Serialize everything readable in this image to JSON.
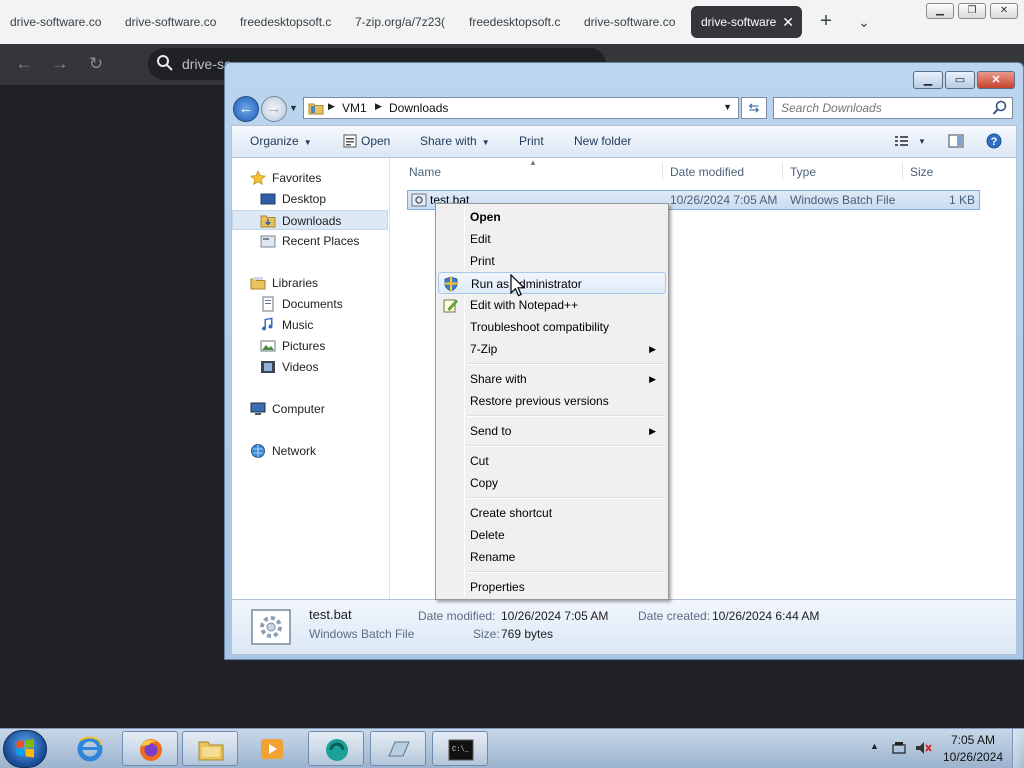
{
  "browser": {
    "tabs": [
      {
        "label": "drive-software.co"
      },
      {
        "label": "drive-software.co"
      },
      {
        "label": "freedesktopsoft.c"
      },
      {
        "label": "7-zip.org/a/7z23("
      },
      {
        "label": "freedesktopsoft.c"
      },
      {
        "label": "drive-software.co"
      },
      {
        "label": "drive-software"
      }
    ],
    "new_tab": "+",
    "address_text": "drive-so"
  },
  "explorer": {
    "breadcrumb": [
      "VM1",
      "Downloads"
    ],
    "search_placeholder": "Search Downloads",
    "toolbar": {
      "organize": "Organize",
      "open": "Open",
      "share_with": "Share with",
      "print": "Print",
      "new_folder": "New folder"
    },
    "nav": {
      "favorites": "Favorites",
      "desktop": "Desktop",
      "downloads": "Downloads",
      "recent_places": "Recent Places",
      "libraries": "Libraries",
      "documents": "Documents",
      "music": "Music",
      "pictures": "Pictures",
      "videos": "Videos",
      "computer": "Computer",
      "network": "Network"
    },
    "columns": {
      "name": "Name",
      "date_modified": "Date modified",
      "type": "Type",
      "size": "Size"
    },
    "files": [
      {
        "name": "test.bat",
        "date_modified": "10/26/2024 7:05 AM",
        "type": "Windows Batch File",
        "size": "1 KB"
      }
    ],
    "details": {
      "name": "test.bat",
      "type": "Windows Batch File",
      "date_modified_label": "Date modified:",
      "date_modified": "10/26/2024 7:05 AM",
      "size_label": "Size:",
      "size": "769 bytes",
      "date_created_label": "Date created:",
      "date_created": "10/26/2024 6:44 AM"
    }
  },
  "context_menu": {
    "open": "Open",
    "edit": "Edit",
    "print": "Print",
    "run_as_admin": "Run as administrator",
    "edit_notepadpp": "Edit with Notepad++",
    "troubleshoot": "Troubleshoot compatibility",
    "seven_zip": "7-Zip",
    "share_with": "Share with",
    "restore": "Restore previous versions",
    "send_to": "Send to",
    "cut": "Cut",
    "copy": "Copy",
    "create_shortcut": "Create shortcut",
    "delete": "Delete",
    "rename": "Rename",
    "properties": "Properties"
  },
  "taskbar": {
    "time": "7:05 AM",
    "date": "10/26/2024"
  }
}
